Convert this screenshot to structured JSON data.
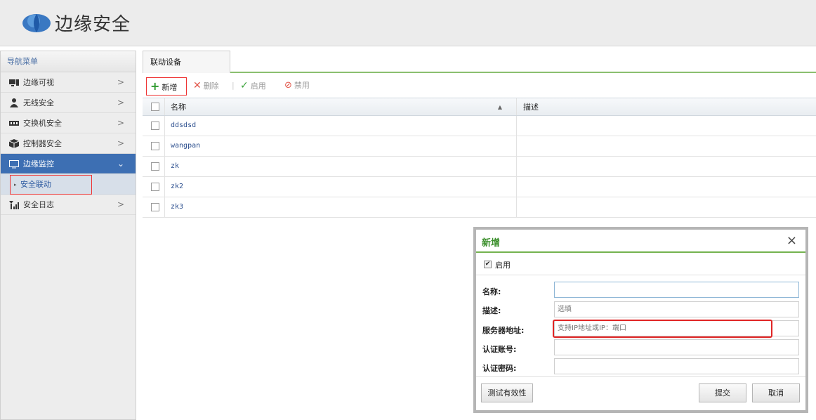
{
  "app": {
    "title": "边缘安全"
  },
  "sidebar": {
    "title": "导航菜单",
    "items": [
      {
        "label": "边缘可视",
        "icon": "display-icon",
        "arrow": ">"
      },
      {
        "label": "无线安全",
        "icon": "user-icon",
        "arrow": ">"
      },
      {
        "label": "交换机安全",
        "icon": "switch-icon",
        "arrow": ">"
      },
      {
        "label": "控制器安全",
        "icon": "cube-icon",
        "arrow": ">"
      },
      {
        "label": "边缘监控",
        "icon": "monitor-icon",
        "arrow": "⌄",
        "active": true
      },
      {
        "label": "安全日志",
        "icon": "signal-icon",
        "arrow": ">"
      }
    ],
    "sub_item": {
      "label": "安全联动",
      "marker": "▸"
    }
  },
  "tab": {
    "label": "联动设备"
  },
  "toolbar": {
    "add": "新增",
    "delete": "删除",
    "separator": "|",
    "enable": "启用",
    "disable": "禁用"
  },
  "table": {
    "columns": [
      "名称",
      "描述"
    ],
    "sort_marker": "▲",
    "rows": [
      {
        "name": "ddsdsd",
        "desc": ""
      },
      {
        "name": "wangpan",
        "desc": ""
      },
      {
        "name": "zk",
        "desc": ""
      },
      {
        "name": "zk2",
        "desc": ""
      },
      {
        "name": "zk3",
        "desc": ""
      }
    ]
  },
  "dialog": {
    "title": "新增",
    "close": "×",
    "enable_label": "启用",
    "enable_checked": "✔",
    "fields": [
      {
        "label": "名称:",
        "value": "",
        "placeholder": ""
      },
      {
        "label": "描述:",
        "value": "",
        "placeholder": "选填"
      },
      {
        "label": "服务器地址:",
        "value": "",
        "placeholder": "支持IP地址或IP：端口"
      },
      {
        "label": "认证账号:",
        "value": "",
        "placeholder": ""
      },
      {
        "label": "认证密码:",
        "value": "",
        "placeholder": ""
      }
    ],
    "test_button": "测试有效性",
    "submit_button": "提交",
    "cancel_button": "取消"
  },
  "colors": {
    "accent": "#3d6fb3",
    "green": "#3b8f2c",
    "highlight": "#e02525"
  }
}
